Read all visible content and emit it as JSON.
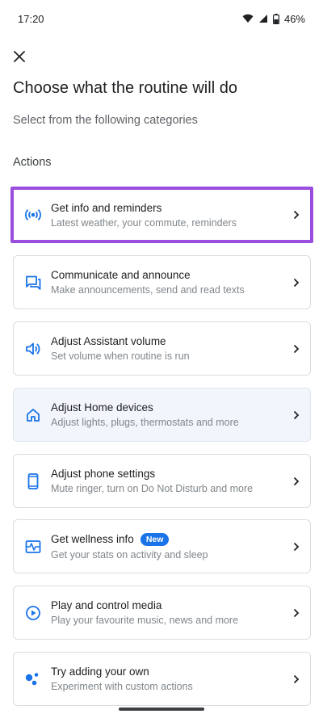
{
  "status": {
    "time": "17:20",
    "battery": "46%"
  },
  "header": {
    "title": "Choose what the routine will do",
    "subtitle": "Select from the following categories",
    "section_label": "Actions"
  },
  "colors": {
    "accent": "#1a73e8",
    "highlight": "#9b4dde"
  },
  "actions": [
    {
      "title": "Get info and reminders",
      "subtitle": "Latest weather, your commute, reminders",
      "icon": "broadcast-icon"
    },
    {
      "title": "Communicate and announce",
      "subtitle": "Make announcements, send and read texts",
      "icon": "chat-icon"
    },
    {
      "title": "Adjust Assistant volume",
      "subtitle": "Set volume when routine is run",
      "icon": "volume-icon"
    },
    {
      "title": "Adjust Home devices",
      "subtitle": "Adjust lights, plugs, thermostats and more",
      "icon": "home-icon"
    },
    {
      "title": "Adjust phone settings",
      "subtitle": "Mute ringer, turn on Do Not Disturb and more",
      "icon": "phone-icon"
    },
    {
      "title": "Get wellness info",
      "badge": "New",
      "subtitle": "Get your stats on activity and sleep",
      "icon": "wellness-icon"
    },
    {
      "title": "Play and control media",
      "subtitle": "Play your favourite music, news and more",
      "icon": "play-icon"
    },
    {
      "title": "Try adding your own",
      "subtitle": "Experiment with custom actions",
      "icon": "assistant-dots-icon"
    }
  ]
}
